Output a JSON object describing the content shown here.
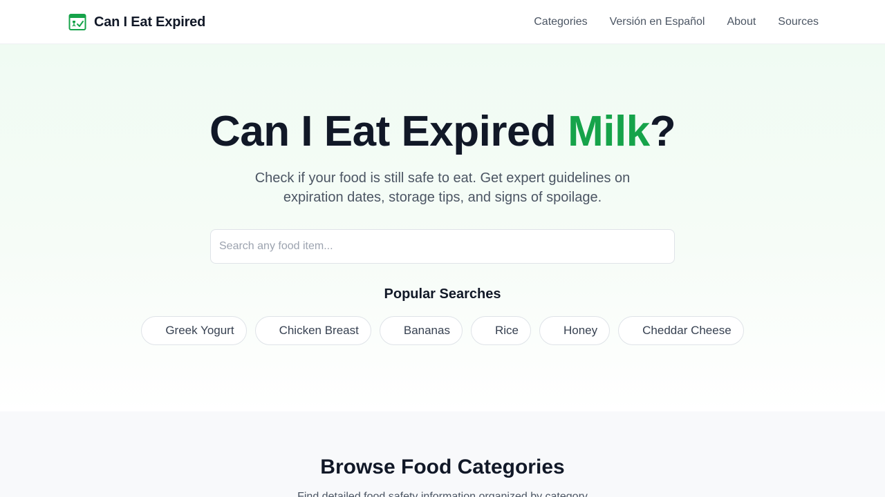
{
  "header": {
    "brand": "Can I Eat Expired",
    "nav": [
      "Categories",
      "Versión en Español",
      "About",
      "Sources"
    ]
  },
  "hero": {
    "title_prefix": "Can I Eat Expired ",
    "title_accent": "Milk",
    "title_suffix": "?",
    "subtitle": "Check if your food is still safe to eat. Get expert guidelines on expiration dates, storage tips, and signs of spoilage.",
    "search_placeholder": "Search any food item..."
  },
  "popular": {
    "title": "Popular Searches",
    "items": [
      "Greek Yogurt",
      "Chicken Breast",
      "Bananas",
      "Rice",
      "Honey",
      "Cheddar Cheese"
    ]
  },
  "categories_section": {
    "title": "Browse Food Categories",
    "subtitle": "Find detailed food safety information organized by category"
  },
  "colors": {
    "accent": "#16a34a",
    "text": "#111827",
    "muted": "#4b5563"
  }
}
